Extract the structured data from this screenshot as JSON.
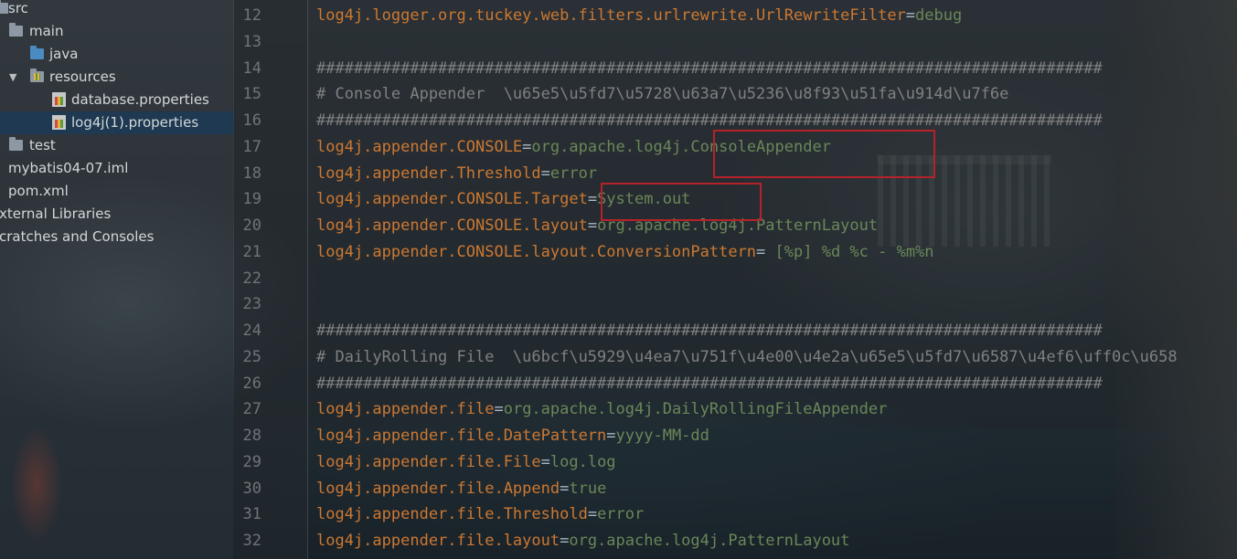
{
  "project_tree": {
    "items": [
      {
        "label": "src"
      },
      {
        "label": "main"
      },
      {
        "label": "java"
      },
      {
        "label": "resources"
      },
      {
        "label": "database.properties"
      },
      {
        "label": "log4j(1).properties"
      },
      {
        "label": "test"
      },
      {
        "label": "mybatis04-07.iml"
      },
      {
        "label": "pom.xml"
      },
      {
        "label": "xternal Libraries"
      },
      {
        "label": "cratches and Consoles"
      }
    ]
  },
  "editor": {
    "lines": [
      {
        "num": "12",
        "key": "log4j.logger.org.tuckey.web.filters.urlrewrite.UrlRewriteFilter",
        "eq": "=",
        "value": "debug"
      },
      {
        "num": "13",
        "key": "",
        "eq": "",
        "value": ""
      },
      {
        "num": "14",
        "comment": "####################################################################################"
      },
      {
        "num": "15",
        "comment": "# Console Appender  \\u65e5\\u5fd7\\u5728\\u63a7\\u5236\\u8f93\\u51fa\\u914d\\u7f6e"
      },
      {
        "num": "16",
        "comment": "####################################################################################"
      },
      {
        "num": "17",
        "key": "log4j.appender.CONSOLE",
        "eq": "=",
        "value": "org.apache.log4j.ConsoleAppender"
      },
      {
        "num": "18",
        "key": "log4j.appender.Threshold",
        "eq": "=",
        "value": "error"
      },
      {
        "num": "19",
        "key": "log4j.appender.CONSOLE.Target",
        "eq": "=",
        "value": "System.out"
      },
      {
        "num": "20",
        "key": "log4j.appender.CONSOLE.layout",
        "eq": "=",
        "value": "org.apache.log4j.PatternLayout"
      },
      {
        "num": "21",
        "key": "log4j.appender.CONSOLE.layout.ConversionPattern",
        "eq": "=",
        "value": " [%p] %d %c - %m%n"
      },
      {
        "num": "22",
        "key": "",
        "eq": "",
        "value": ""
      },
      {
        "num": "23",
        "key": "",
        "eq": "",
        "value": ""
      },
      {
        "num": "24",
        "comment": "####################################################################################"
      },
      {
        "num": "25",
        "comment": "# DailyRolling File  \\u6bcf\\u5929\\u4ea7\\u751f\\u4e00\\u4e2a\\u65e5\\u5fd7\\u6587\\u4ef6\\uff0c\\u658"
      },
      {
        "num": "26",
        "comment": "####################################################################################"
      },
      {
        "num": "27",
        "key": "log4j.appender.file",
        "eq": "=",
        "value": "org.apache.log4j.DailyRollingFileAppender"
      },
      {
        "num": "28",
        "key": "log4j.appender.file.DatePattern",
        "eq": "=",
        "value": "yyyy-MM-dd"
      },
      {
        "num": "29",
        "key": "log4j.appender.file.File",
        "eq": "=",
        "value": "log.log"
      },
      {
        "num": "30",
        "key": "log4j.appender.file.Append",
        "eq": "=",
        "value": "true"
      },
      {
        "num": "31",
        "key": "log4j.appender.file.Threshold",
        "eq": "=",
        "value": "error"
      },
      {
        "num": "32",
        "key": "log4j.appender.file.layout",
        "eq": "=",
        "value": "org.apache.log4j.PatternLayout"
      }
    ]
  },
  "colors": {
    "key": "#cc7832",
    "value": "#6a8759",
    "comment": "#808080",
    "highlight_box": "#b5222a",
    "selection": "#1e3a52"
  }
}
